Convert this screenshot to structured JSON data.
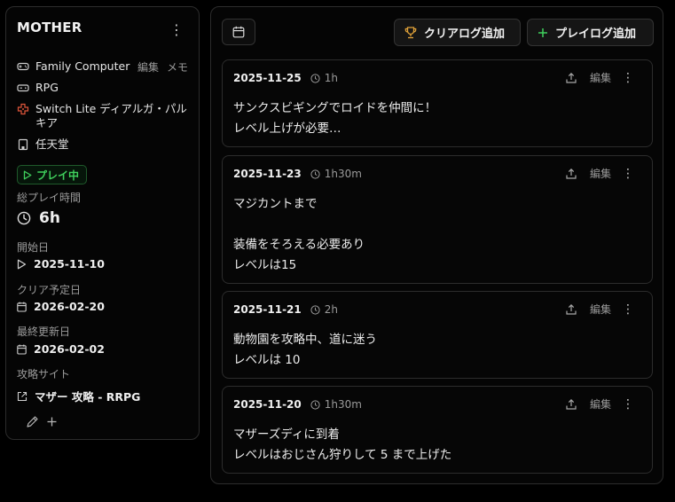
{
  "game": {
    "title": "MOTHER",
    "platform": "Family Computer",
    "platform_edit": "編集",
    "platform_memo": "メモ",
    "genre": "RPG",
    "device": "Switch Lite ディアルガ・パルキア",
    "publisher": "任天堂",
    "status": "プレイ中"
  },
  "stats": {
    "total_label": "総プレイ時間",
    "total_value": "6h",
    "start_label": "開始日",
    "start_value": "2025-11-10",
    "clear_label": "クリア予定日",
    "clear_value": "2026-02-20",
    "updated_label": "最終更新日",
    "updated_value": "2026-02-02",
    "site_label": "攻略サイト",
    "site_value": "マザー 攻略 - RRPG"
  },
  "toolbar": {
    "clear_log_label": "クリアログ追加",
    "play_log_label": "プレイログ追加"
  },
  "logs": [
    {
      "date": "2025-11-25",
      "duration": "1h",
      "edit_label": "編集",
      "body": "サンクスビギングでロイドを仲間に！\nレベル上げが必要…"
    },
    {
      "date": "2025-11-23",
      "duration": "1h30m",
      "edit_label": "編集",
      "body": "マジカントまで\n\n装備をそろえる必要あり\nレベルは15"
    },
    {
      "date": "2025-11-21",
      "duration": "2h",
      "edit_label": "編集",
      "body": "動物園を攻略中、道に迷う\nレベルは 10"
    },
    {
      "date": "2025-11-20",
      "duration": "1h30m",
      "edit_label": "編集",
      "body": "マザーズディに到着\nレベルはおじさん狩りして 5 まで上げた"
    }
  ],
  "colors": {
    "accent_green": "#3fcf5c",
    "trophy_orange": "#e3a43a",
    "background": "#000000",
    "border": "#2c2c2c"
  }
}
